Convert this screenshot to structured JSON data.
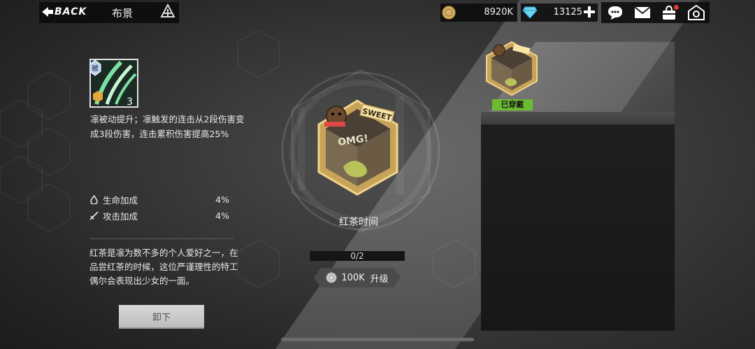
{
  "header": {
    "back_label": "BACK",
    "page_title": "布景",
    "coins": "8920K",
    "gems": "13125"
  },
  "skill": {
    "badge": "被",
    "level": "3",
    "description": "凛被动提升；凛触发的连击从2段伤害变成3段伤害，连击累积伤害提高25%"
  },
  "stats": [
    {
      "label": "生命加成",
      "value": "4%",
      "icon": "droplet-icon"
    },
    {
      "label": "攻击加成",
      "value": "4%",
      "icon": "sword-icon"
    }
  ],
  "lore": "红茶是凛为数不多的个人爱好之一，在品尝红茶的时候，这位严谨理性的特工偶尔会表现出少女的一面。",
  "unequip_label": "卸下",
  "item": {
    "name": "红茶时间",
    "progress": "0/2",
    "progress_fraction": 0,
    "upgrade_cost": "100K",
    "upgrade_label": "升级",
    "art_text_sweet": "SWEET",
    "art_text_omg": "OMG!"
  },
  "slot": {
    "equipped_label": "已穿戴"
  },
  "colors": {
    "equipped_green": "#6dbb2f",
    "notification_red": "#e53935",
    "gold": "#c8a45a"
  }
}
